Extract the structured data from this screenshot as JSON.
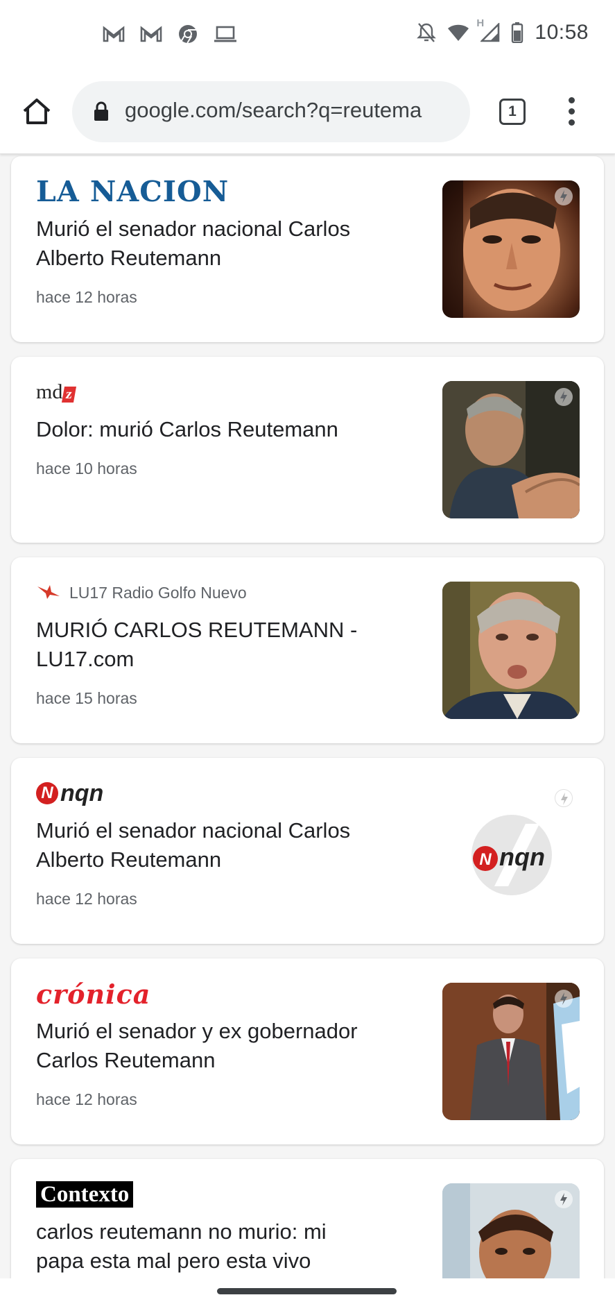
{
  "status_bar": {
    "time": "10:58",
    "left_icons": [
      "gmail-icon",
      "gmail-icon",
      "chrome-icon",
      "laptop-icon"
    ],
    "right_icons": [
      "notifications-off-icon",
      "wifi-icon",
      "signal-icon",
      "battery-icon"
    ],
    "network_label": "H"
  },
  "browser": {
    "url": "google.com/search?q=reutema",
    "tab_count": "1"
  },
  "cards": [
    {
      "source": "LA NACION",
      "headline": "Murió el senador nacional Carlos Alberto Reutemann",
      "time": "hace 12 horas",
      "amp": true
    },
    {
      "source": "mdz",
      "headline": "Dolor: murió Carlos Reutemann",
      "time": "hace 10 horas",
      "amp": true
    },
    {
      "source": "LU17 Radio Golfo Nuevo",
      "headline": "MURIÓ CARLOS REUTEMANN - LU17.com",
      "time": "hace 15 horas",
      "amp": false
    },
    {
      "source": "nqn",
      "headline": "Murió el senador nacional Carlos Alberto Reutemann",
      "time": "hace 12 horas",
      "amp": true,
      "thumb_logo": "nqn"
    },
    {
      "source": "crónica",
      "headline": "Murió el senador y ex gobernador Carlos Reutemann",
      "time": "hace 12 horas",
      "amp": true
    },
    {
      "source": "Contexto",
      "headline": "carlos reutemann no murio: mi papa esta mal pero esta vivo",
      "amp": true
    }
  ]
}
